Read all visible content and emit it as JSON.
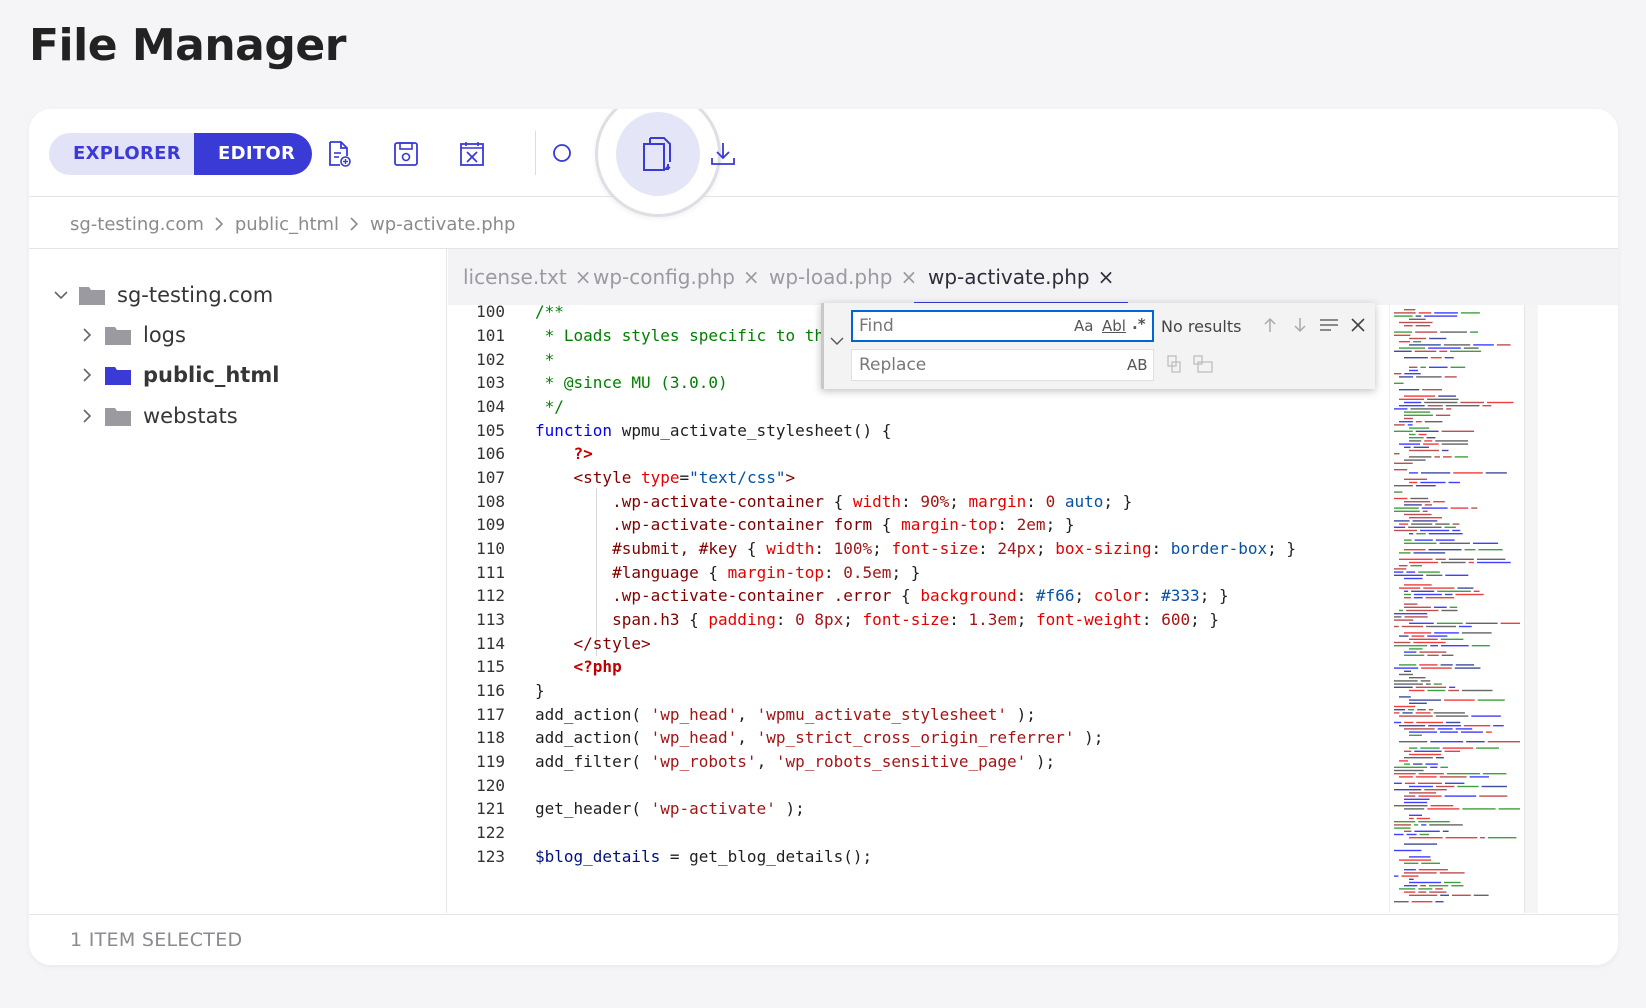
{
  "page": {
    "title": "File Manager"
  },
  "toolbar": {
    "explorer_label": "EXPLORER",
    "editor_label": "EDITOR",
    "icons": [
      "new-file-icon",
      "save-icon",
      "close-file-icon",
      "search-icon",
      "copy-icon",
      "download-icon"
    ],
    "accent": "#3a3ad6"
  },
  "breadcrumb": [
    "sg-testing.com",
    "public_html",
    "wp-activate.php"
  ],
  "tree": {
    "root": "sg-testing.com",
    "children": [
      "logs",
      "public_html",
      "webstats"
    ]
  },
  "tabs": [
    "license.txt",
    "wp-config.php",
    "wp-load.php",
    "wp-activate.php"
  ],
  "active_tab": "wp-activate.php",
  "code": {
    "line_numbers": [
      "100",
      "101",
      "102",
      "103",
      "104",
      "105",
      "106",
      "107",
      "108",
      "109",
      "110",
      "111",
      "112",
      "113",
      "114",
      "115",
      "116",
      "117",
      "118",
      "119",
      "120",
      "121",
      "122",
      "123"
    ]
  },
  "find_widget": {
    "find_placeholder": "Find",
    "replace_placeholder": "Replace",
    "status": "No results",
    "opt_case": "Aa",
    "opt_word": "Abl",
    "opt_regex": ".*",
    "opt_preserve": "AB"
  },
  "status": {
    "text": "1 ITEM SELECTED"
  }
}
